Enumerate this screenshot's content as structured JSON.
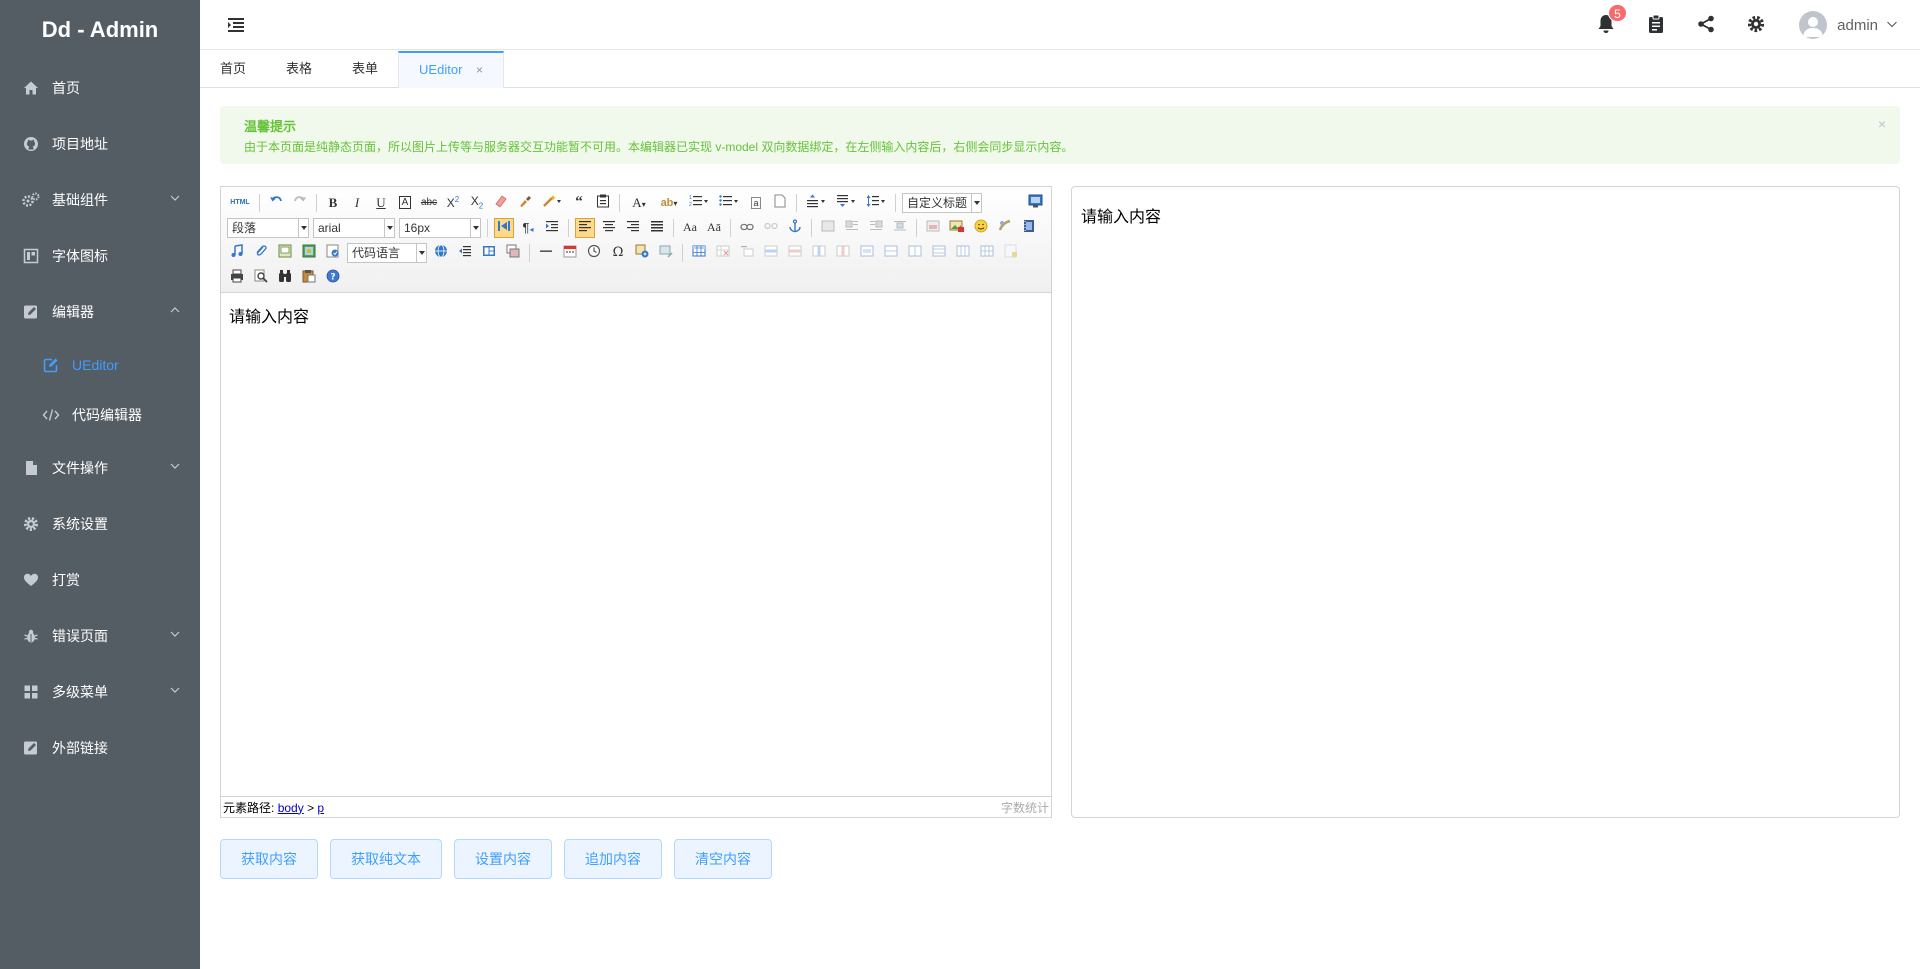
{
  "app": {
    "title": "Dd - Admin"
  },
  "sidebar": {
    "items": [
      {
        "label": "首页",
        "icon": "home-icon"
      },
      {
        "label": "项目地址",
        "icon": "github-icon"
      },
      {
        "label": "基础组件",
        "icon": "gears-icon",
        "has_children": true
      },
      {
        "label": "字体图标",
        "icon": "font-icon"
      },
      {
        "label": "编辑器",
        "icon": "edit-icon",
        "has_children": true,
        "expanded": true
      },
      {
        "label": "文件操作",
        "icon": "file-icon",
        "has_children": true
      },
      {
        "label": "系统设置",
        "icon": "gear-icon"
      },
      {
        "label": "打赏",
        "icon": "heart-icon"
      },
      {
        "label": "错误页面",
        "icon": "bug-icon",
        "has_children": true
      },
      {
        "label": "多级菜单",
        "icon": "grid-icon",
        "has_children": true
      },
      {
        "label": "外部链接",
        "icon": "external-link-icon"
      }
    ],
    "editor_children": [
      {
        "label": "UEditor",
        "icon": "edit-square-icon",
        "active": true
      },
      {
        "label": "代码编辑器",
        "icon": "code-icon"
      }
    ],
    "colors": {
      "background": "#545c64",
      "active_text": "#409eff"
    }
  },
  "header": {
    "notification_count": "5",
    "username": "admin"
  },
  "tabs": [
    {
      "label": "首页"
    },
    {
      "label": "表格"
    },
    {
      "label": "表单"
    },
    {
      "label": "UEditor",
      "active": true,
      "close": "×"
    }
  ],
  "alert": {
    "title": "温馨提示",
    "description": "由于本页面是纯静态页面，所以图片上传等与服务器交互功能暂不可用。本编辑器已实现 v-model 双向数据绑定，在左侧输入内容后，右侧会同步显示内容。",
    "close": "×"
  },
  "editor": {
    "toolbar": {
      "paragraph": "段落",
      "font_family": "arial",
      "font_size": "16px",
      "custom_heading": "自定义标题",
      "code_language": "代码语言"
    },
    "content": "请输入内容",
    "footer": {
      "path_label": "元素路径:",
      "path_body": "body",
      "path_sep": ">",
      "path_p": "p",
      "wordcount": "字数统计"
    }
  },
  "preview": {
    "content": "请输入内容"
  },
  "buttons": [
    {
      "label": "获取内容"
    },
    {
      "label": "获取纯文本"
    },
    {
      "label": "设置内容"
    },
    {
      "label": "追加内容"
    },
    {
      "label": "清空内容"
    }
  ]
}
